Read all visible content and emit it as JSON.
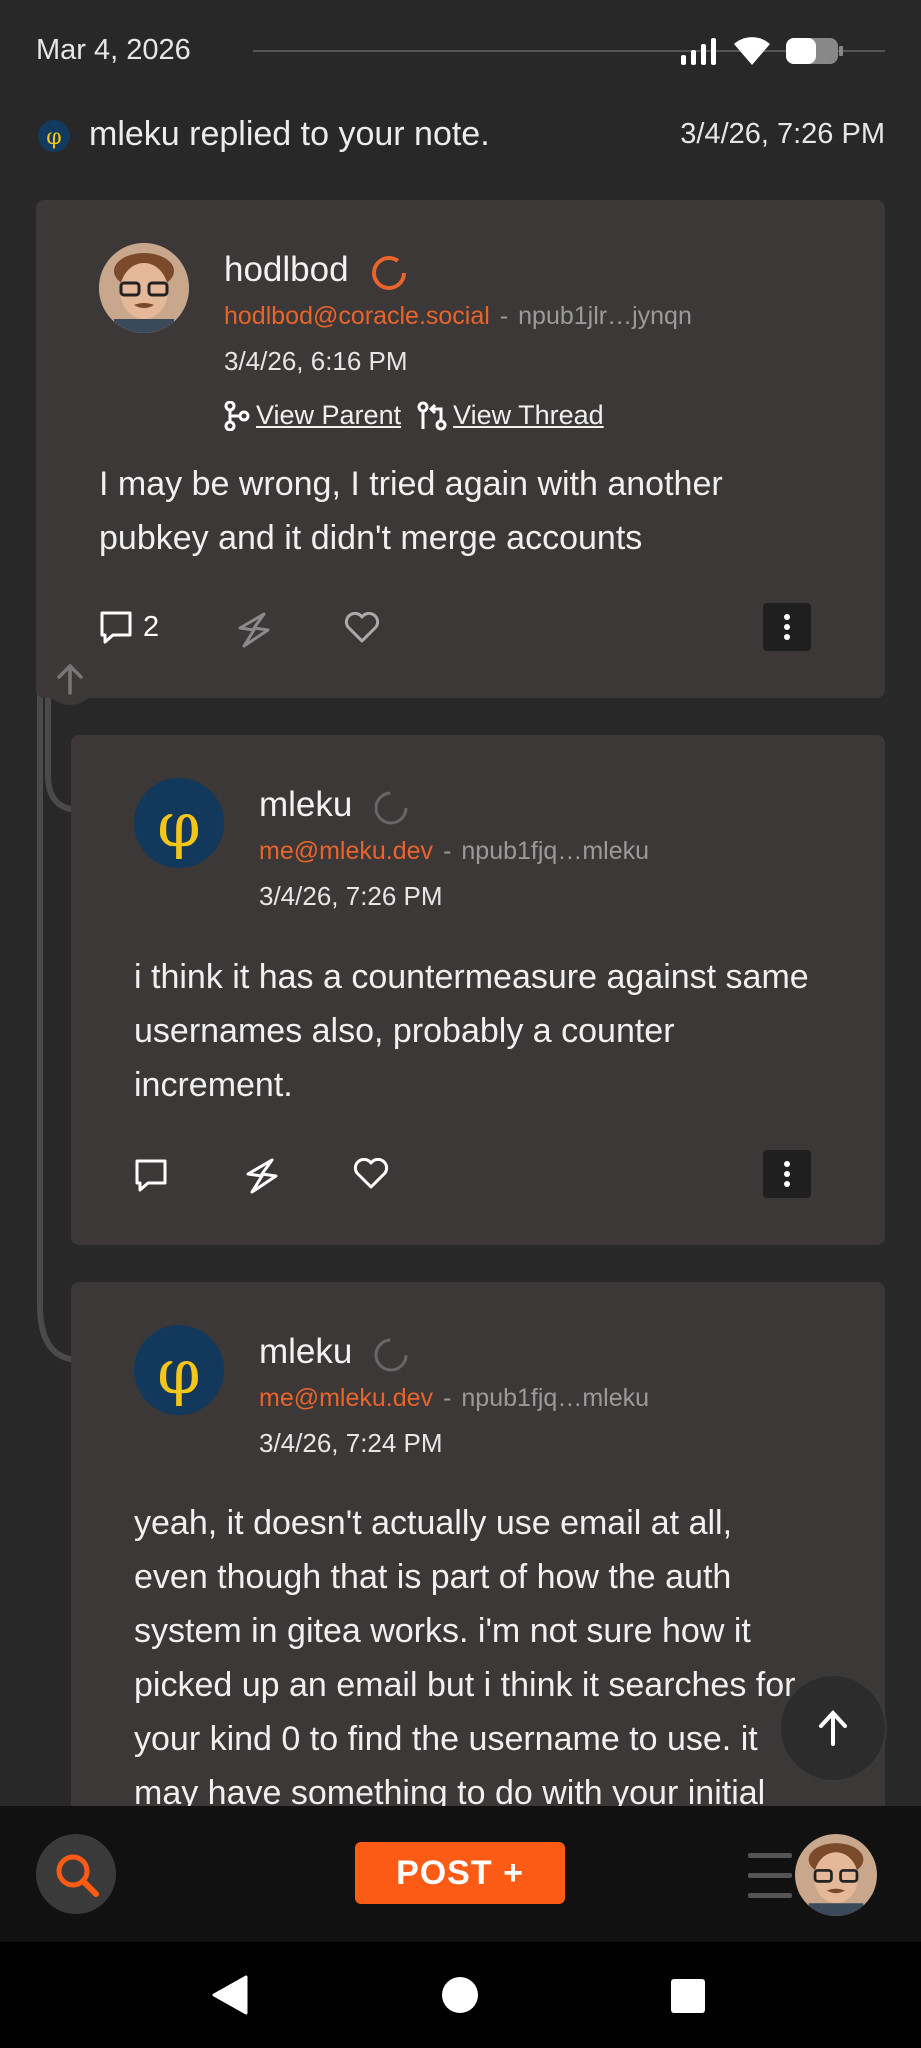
{
  "status_bar": {
    "time_label": "Mar 4, 2026"
  },
  "notification": {
    "text": "mleku replied to your note.",
    "time": "3/4/26, 7:26 PM"
  },
  "posts": [
    {
      "author": "hodlbod",
      "nip05": "hodlbod@coracle.social",
      "npub": "npub1jlr…jynqn",
      "timestamp": "3/4/26, 6:16 PM",
      "view_parent": "View Parent",
      "view_thread": "View Thread",
      "content": "I may be wrong, I tried again with another pubkey and it didn't merge accounts",
      "reply_count": "2"
    },
    {
      "author": "mleku",
      "nip05": "me@mleku.dev",
      "npub": "npub1fjq…mleku",
      "timestamp": "3/4/26, 7:26 PM",
      "content": "i think it has a countermeasure against same usernames also, probably a counter increment."
    },
    {
      "author": "mleku",
      "nip05": "me@mleku.dev",
      "npub": "npub1fjq…mleku",
      "timestamp": "3/4/26, 7:24 PM",
      "content": "yeah, it doesn't actually use email at all, even though that is part of how the auth system in gitea works. i'm not sure how it picked up an email but i think it searches for your kind 0 to find the username to use. it may have something to do with your initial"
    }
  ],
  "separator": "-",
  "bottom_bar": {
    "post_label": "POST +"
  },
  "colors": {
    "accent": "#fb5b14",
    "nip05": "#e8642b",
    "card": "#3b3837",
    "background": "#282828"
  },
  "icons": [
    "search-icon",
    "menu-icon",
    "arrow-up-icon",
    "reply-icon",
    "zap-icon",
    "heart-icon",
    "more-vert-icon",
    "back-icon",
    "home-icon",
    "recents-icon"
  ]
}
